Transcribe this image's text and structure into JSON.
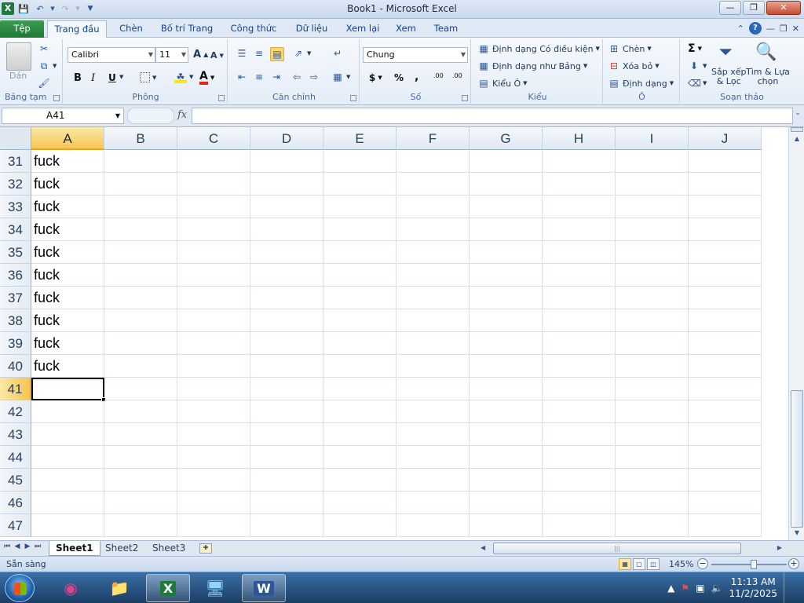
{
  "app": {
    "title": "Book1  -  Microsoft Excel",
    "logo": "X"
  },
  "qat": {
    "save_icon": "save-icon",
    "undo_icon": "undo-icon",
    "redo_icon": "redo-icon"
  },
  "tabs": [
    {
      "label": "Tệp"
    },
    {
      "label": "Trang đầu"
    },
    {
      "label": "Chèn"
    },
    {
      "label": "Bố trí Trang"
    },
    {
      "label": "Công thức"
    },
    {
      "label": "Dữ liệu"
    },
    {
      "label": "Xem lại"
    },
    {
      "label": "Xem"
    },
    {
      "label": "Team"
    }
  ],
  "ribbon": {
    "clipboard": {
      "label": "Bảng tạm",
      "paste": "Dán"
    },
    "font": {
      "label": "Phông",
      "family": "Calibri",
      "size": "11",
      "bold": "B",
      "italic": "I",
      "underline": "U",
      "grow": "A",
      "shrink": "A",
      "font_color": "A"
    },
    "alignment": {
      "label": "Căn chỉnh"
    },
    "number": {
      "label": "Số",
      "format": "Chung",
      "currency": "$",
      "percent": "%",
      "comma": ",",
      "inc_dec": ".00",
      "dec_dec": ".00"
    },
    "styles": {
      "label": "Kiểu",
      "conditional": "Định dạng Có điều kiện",
      "as_table": "Định dạng như Bảng",
      "cell_styles": "Kiểu Ô"
    },
    "cells": {
      "label": "Ô",
      "insert": "Chèn",
      "delete": "Xóa bỏ",
      "format": "Định dạng"
    },
    "editing": {
      "label": "Soạn thảo",
      "sum": "Σ",
      "sort": "Sắp xếp\n& Lọc",
      "find": "Tìm & Lựa\nchọn"
    }
  },
  "formula_bar": {
    "name_box": "A41",
    "fx": "fx",
    "value": ""
  },
  "grid": {
    "columns": [
      "A",
      "B",
      "C",
      "D",
      "E",
      "F",
      "G",
      "H",
      "I",
      "J"
    ],
    "selected_column": "A",
    "rows": [
      {
        "num": "31",
        "a": "fuck"
      },
      {
        "num": "32",
        "a": "fuck"
      },
      {
        "num": "33",
        "a": "fuck"
      },
      {
        "num": "34",
        "a": "fuck"
      },
      {
        "num": "35",
        "a": "fuck"
      },
      {
        "num": "36",
        "a": "fuck"
      },
      {
        "num": "37",
        "a": "fuck"
      },
      {
        "num": "38",
        "a": "fuck"
      },
      {
        "num": "39",
        "a": "fuck"
      },
      {
        "num": "40",
        "a": "fuck"
      },
      {
        "num": "41",
        "a": ""
      },
      {
        "num": "42",
        "a": ""
      },
      {
        "num": "43",
        "a": ""
      },
      {
        "num": "44",
        "a": ""
      },
      {
        "num": "45",
        "a": ""
      },
      {
        "num": "46",
        "a": ""
      },
      {
        "num": "47",
        "a": ""
      }
    ],
    "active_cell": "A41",
    "selected_row": "41"
  },
  "sheets": [
    {
      "label": "Sheet1",
      "active": true
    },
    {
      "label": "Sheet2",
      "active": false
    },
    {
      "label": "Sheet3",
      "active": false
    }
  ],
  "status": {
    "text": "Sẵn sàng",
    "zoom": "145%"
  },
  "taskbar": {
    "time": "11:13 AM",
    "date": "11/2/2025"
  },
  "colors": {
    "excel_green": "#1d7a3a",
    "selection_header": "#f5c552",
    "ribbon_bg": "#e4edf8"
  }
}
